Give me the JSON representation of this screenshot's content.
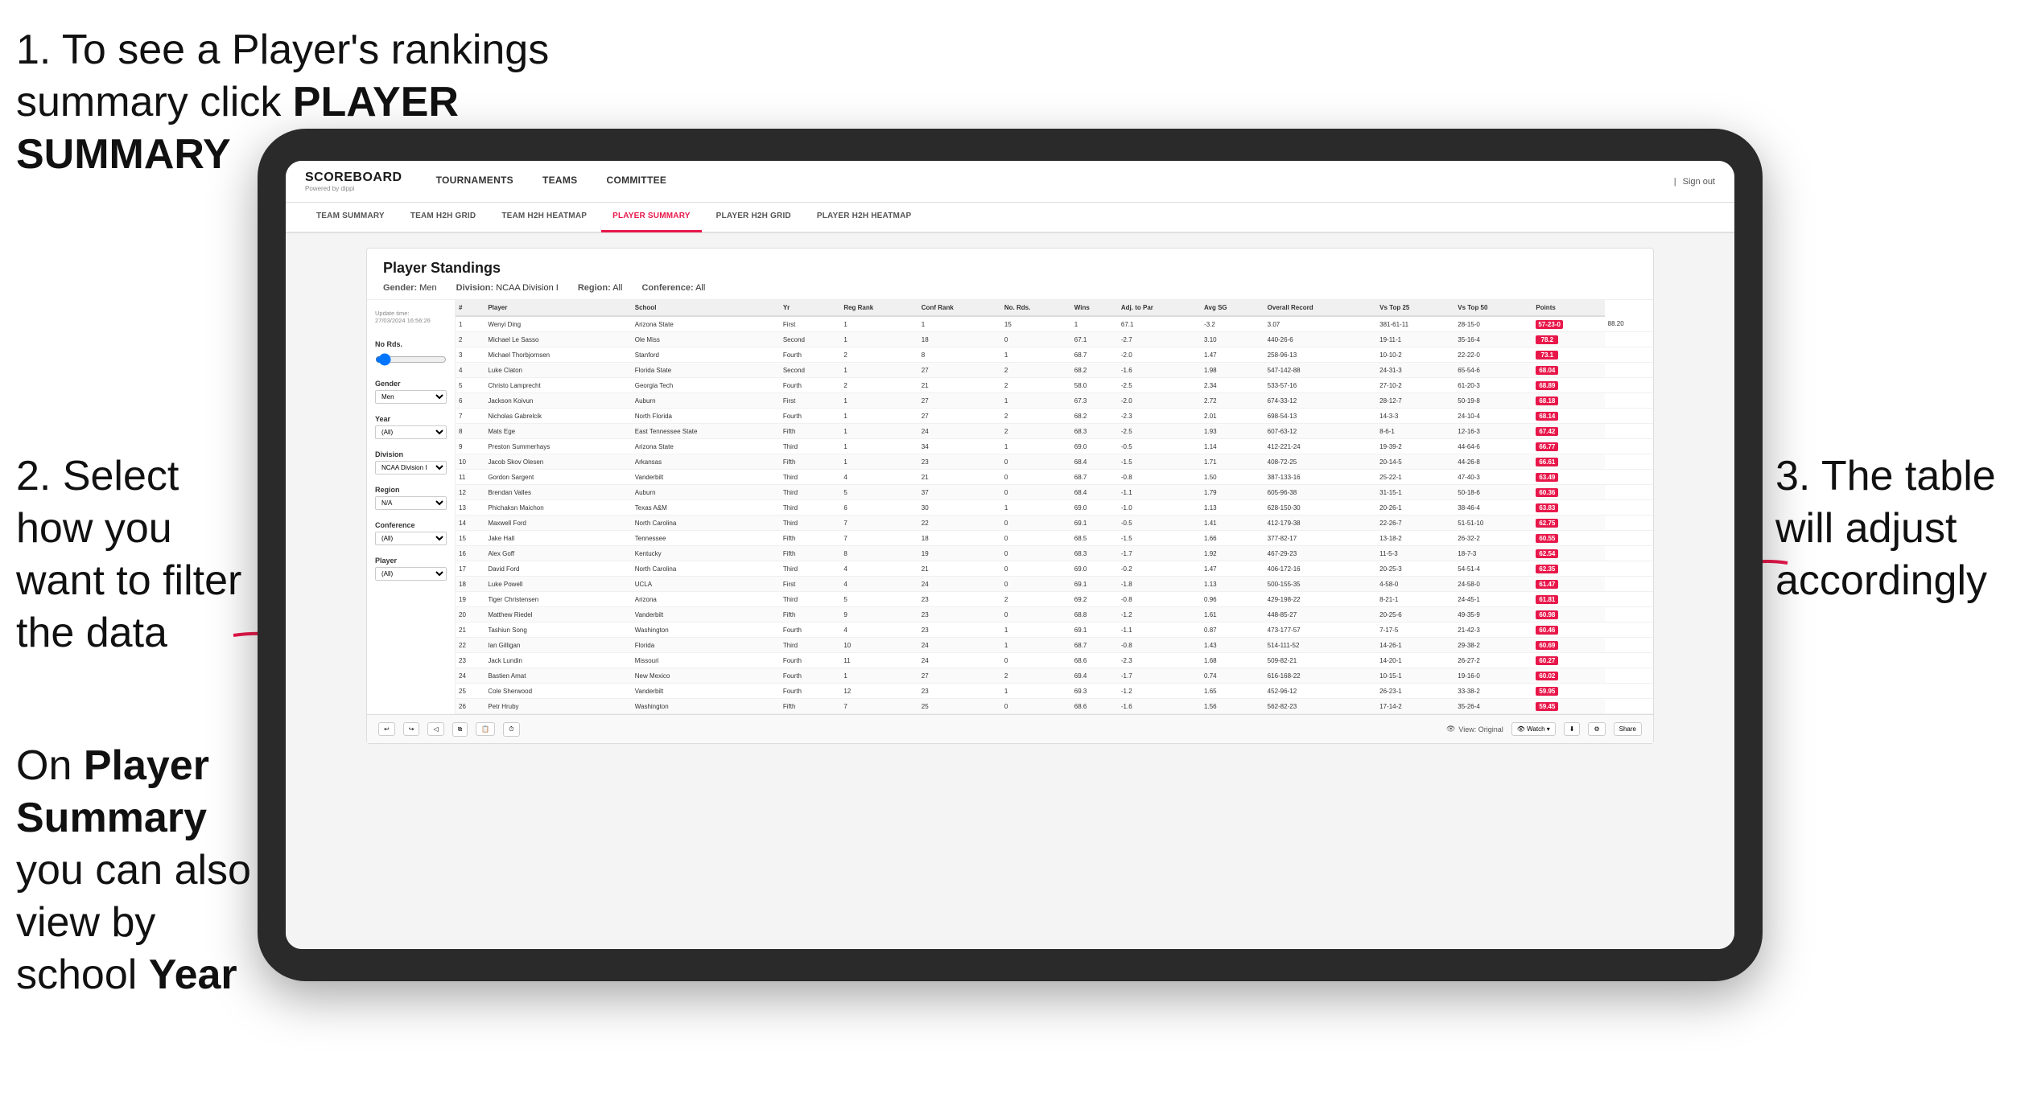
{
  "annotations": {
    "annotation1": "1. To see a Player's rankings summary click ",
    "annotation1_bold": "PLAYER SUMMARY",
    "annotation2_title": "2. Select how you want to filter the data",
    "annotation3_title": "3. The table will adjust accordingly",
    "annotation_bottom": "On ",
    "annotation_bottom_bold1": "Player Summary",
    "annotation_bottom_mid": " you can also view by school ",
    "annotation_bottom_bold2": "Year"
  },
  "nav": {
    "logo": "SCOREBOARD",
    "logo_sub": "Powered by dippi",
    "items": [
      "TOURNAMENTS",
      "TEAMS",
      "COMMITTEE"
    ],
    "sign_out": "Sign out",
    "pipe": "|"
  },
  "subnav": {
    "items": [
      "TEAM SUMMARY",
      "TEAM H2H GRID",
      "TEAM H2H HEATMAP",
      "PLAYER SUMMARY",
      "PLAYER H2H GRID",
      "PLAYER H2H HEATMAP"
    ],
    "active": "PLAYER SUMMARY"
  },
  "panel": {
    "title": "Player Standings",
    "update_time_label": "Update time:",
    "update_time": "27/03/2024 16:56:26",
    "gender_label": "Gender:",
    "gender_value": "Men",
    "division_label": "Division:",
    "division_value": "NCAA Division I",
    "region_label": "Region:",
    "region_value": "All",
    "conference_label": "Conference:",
    "conference_value": "All"
  },
  "sidebar": {
    "no_rds_label": "No Rds.",
    "gender_label": "Gender",
    "gender_value": "Men",
    "year_label": "Year",
    "year_value": "(All)",
    "division_label": "Division",
    "division_value": "NCAA Division I",
    "region_label": "Region",
    "region_value": "N/A",
    "conference_label": "Conference",
    "conference_value": "(All)",
    "player_label": "Player",
    "player_value": "(All)"
  },
  "table": {
    "headers": [
      "#",
      "Player",
      "School",
      "Yr",
      "Reg Rank",
      "Conf Rank",
      "No. Rds.",
      "Wins",
      "Adj. to Par",
      "Avg SG",
      "Overall Record",
      "Vs Top 25",
      "Vs Top 50",
      "Points"
    ],
    "rows": [
      [
        "1",
        "Wenyi Ding",
        "Arizona State",
        "First",
        "1",
        "1",
        "15",
        "1",
        "67.1",
        "-3.2",
        "3.07",
        "381-61-11",
        "28-15-0",
        "57-23-0",
        "88.20"
      ],
      [
        "2",
        "Michael Le Sasso",
        "Ole Miss",
        "Second",
        "1",
        "18",
        "0",
        "67.1",
        "-2.7",
        "3.10",
        "440-26-6",
        "19-11-1",
        "35-16-4",
        "78.2"
      ],
      [
        "3",
        "Michael Thorbjornsen",
        "Stanford",
        "Fourth",
        "2",
        "8",
        "1",
        "68.7",
        "-2.0",
        "1.47",
        "258-96-13",
        "10-10-2",
        "22-22-0",
        "73.1"
      ],
      [
        "4",
        "Luke Claton",
        "Florida State",
        "Second",
        "1",
        "27",
        "2",
        "68.2",
        "-1.6",
        "1.98",
        "547-142-88",
        "24-31-3",
        "65-54-6",
        "68.04"
      ],
      [
        "5",
        "Christo Lamprecht",
        "Georgia Tech",
        "Fourth",
        "2",
        "21",
        "2",
        "58.0",
        "-2.5",
        "2.34",
        "533-57-16",
        "27-10-2",
        "61-20-3",
        "68.89"
      ],
      [
        "6",
        "Jackson Koivun",
        "Auburn",
        "First",
        "1",
        "27",
        "1",
        "67.3",
        "-2.0",
        "2.72",
        "674-33-12",
        "28-12-7",
        "50-19-8",
        "68.18"
      ],
      [
        "7",
        "Nicholas Gabrelcik",
        "North Florida",
        "Fourth",
        "1",
        "27",
        "2",
        "68.2",
        "-2.3",
        "2.01",
        "698-54-13",
        "14-3-3",
        "24-10-4",
        "68.14"
      ],
      [
        "8",
        "Mats Ege",
        "East Tennessee State",
        "Fifth",
        "1",
        "24",
        "2",
        "68.3",
        "-2.5",
        "1.93",
        "607-63-12",
        "8-6-1",
        "12-16-3",
        "67.42"
      ],
      [
        "9",
        "Preston Summerhays",
        "Arizona State",
        "Third",
        "1",
        "34",
        "1",
        "69.0",
        "-0.5",
        "1.14",
        "412-221-24",
        "19-39-2",
        "44-64-6",
        "66.77"
      ],
      [
        "10",
        "Jacob Skov Olesen",
        "Arkansas",
        "Fifth",
        "1",
        "23",
        "0",
        "68.4",
        "-1.5",
        "1.71",
        "408-72-25",
        "20-14-5",
        "44-26-8",
        "66.61"
      ],
      [
        "11",
        "Gordon Sargent",
        "Vanderbilt",
        "Third",
        "4",
        "21",
        "0",
        "68.7",
        "-0.8",
        "1.50",
        "387-133-16",
        "25-22-1",
        "47-40-3",
        "63.49"
      ],
      [
        "12",
        "Brendan Valles",
        "Auburn",
        "Third",
        "5",
        "37",
        "0",
        "68.4",
        "-1.1",
        "1.79",
        "605-96-38",
        "31-15-1",
        "50-18-6",
        "60.36"
      ],
      [
        "13",
        "Phichaksn Maichon",
        "Texas A&M",
        "Third",
        "6",
        "30",
        "1",
        "69.0",
        "-1.0",
        "1.13",
        "628-150-30",
        "20-26-1",
        "38-46-4",
        "63.83"
      ],
      [
        "14",
        "Maxwell Ford",
        "North Carolina",
        "Third",
        "7",
        "22",
        "0",
        "69.1",
        "-0.5",
        "1.41",
        "412-179-38",
        "22-26-7",
        "51-51-10",
        "62.75"
      ],
      [
        "15",
        "Jake Hall",
        "Tennessee",
        "Fifth",
        "7",
        "18",
        "0",
        "68.5",
        "-1.5",
        "1.66",
        "377-82-17",
        "13-18-2",
        "26-32-2",
        "60.55"
      ],
      [
        "16",
        "Alex Goff",
        "Kentucky",
        "Fifth",
        "8",
        "19",
        "0",
        "68.3",
        "-1.7",
        "1.92",
        "467-29-23",
        "11-5-3",
        "18-7-3",
        "62.54"
      ],
      [
        "17",
        "David Ford",
        "North Carolina",
        "Third",
        "4",
        "21",
        "0",
        "69.0",
        "-0.2",
        "1.47",
        "406-172-16",
        "20-25-3",
        "54-51-4",
        "62.35"
      ],
      [
        "18",
        "Luke Powell",
        "UCLA",
        "First",
        "4",
        "24",
        "0",
        "69.1",
        "-1.8",
        "1.13",
        "500-155-35",
        "4-58-0",
        "24-58-0",
        "61.47"
      ],
      [
        "19",
        "Tiger Christensen",
        "Arizona",
        "Third",
        "5",
        "23",
        "2",
        "69.2",
        "-0.8",
        "0.96",
        "429-198-22",
        "8-21-1",
        "24-45-1",
        "61.81"
      ],
      [
        "20",
        "Matthew Riedel",
        "Vanderbilt",
        "Fifth",
        "9",
        "23",
        "0",
        "68.8",
        "-1.2",
        "1.61",
        "448-85-27",
        "20-25-6",
        "49-35-9",
        "60.98"
      ],
      [
        "21",
        "Tashiun Song",
        "Washington",
        "Fourth",
        "4",
        "23",
        "1",
        "69.1",
        "-1.1",
        "0.87",
        "473-177-57",
        "7-17-5",
        "21-42-3",
        "60.46"
      ],
      [
        "22",
        "Ian Gilligan",
        "Florida",
        "Third",
        "10",
        "24",
        "1",
        "68.7",
        "-0.8",
        "1.43",
        "514-111-52",
        "14-26-1",
        "29-38-2",
        "60.69"
      ],
      [
        "23",
        "Jack Lundin",
        "Missouri",
        "Fourth",
        "11",
        "24",
        "0",
        "68.6",
        "-2.3",
        "1.68",
        "509-82-21",
        "14-20-1",
        "26-27-2",
        "60.27"
      ],
      [
        "24",
        "Bastien Amat",
        "New Mexico",
        "Fourth",
        "1",
        "27",
        "2",
        "69.4",
        "-1.7",
        "0.74",
        "616-168-22",
        "10-15-1",
        "19-16-0",
        "60.02"
      ],
      [
        "25",
        "Cole Sherwood",
        "Vanderbilt",
        "Fourth",
        "12",
        "23",
        "1",
        "69.3",
        "-1.2",
        "1.65",
        "452-96-12",
        "26-23-1",
        "33-38-2",
        "59.95"
      ],
      [
        "26",
        "Petr Hruby",
        "Washington",
        "Fifth",
        "7",
        "25",
        "0",
        "68.6",
        "-1.6",
        "1.56",
        "562-82-23",
        "17-14-2",
        "35-26-4",
        "59.45"
      ]
    ]
  },
  "toolbar": {
    "view_label": "View: Original",
    "watch_label": "Watch",
    "share_label": "Share"
  }
}
